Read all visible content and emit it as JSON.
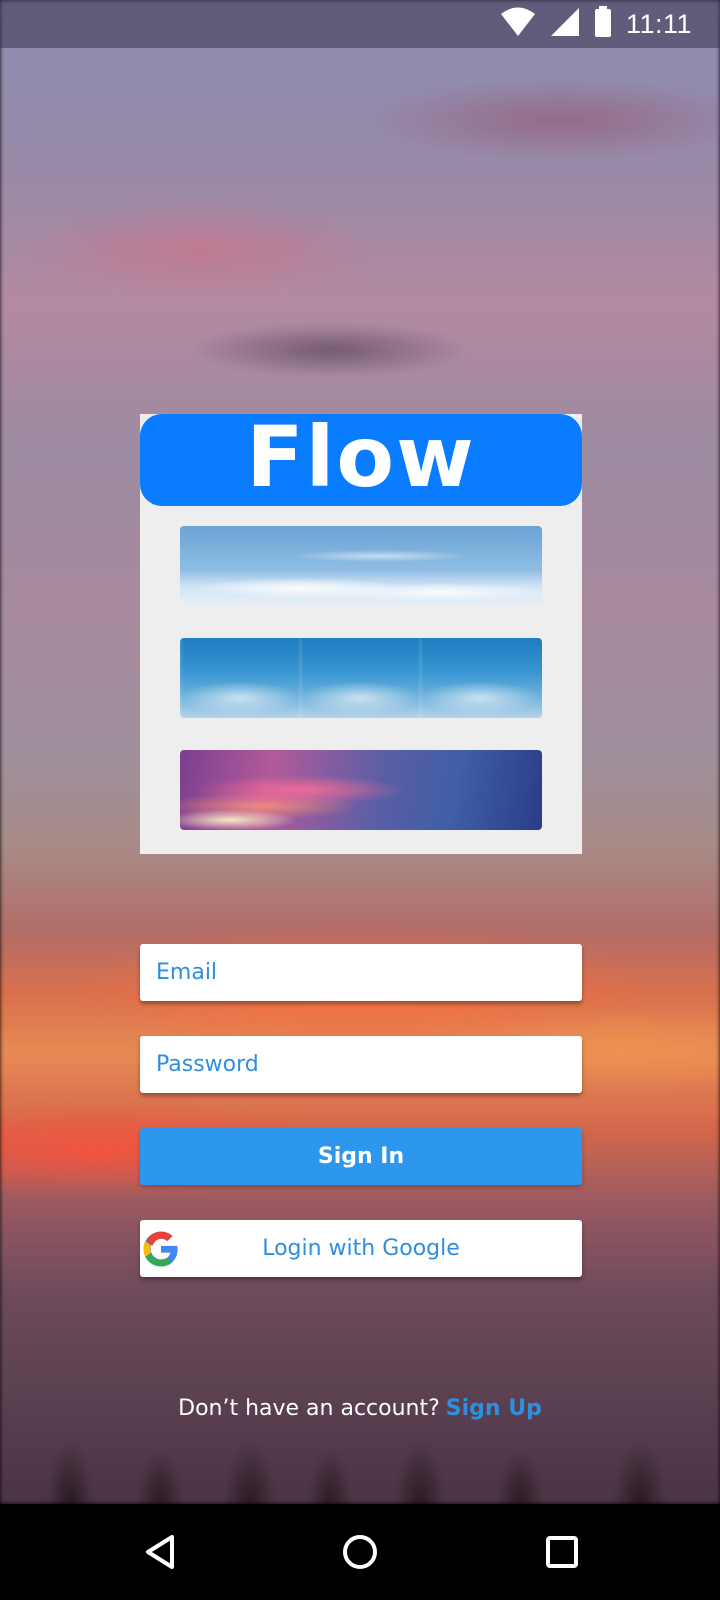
{
  "status_bar": {
    "time": "11:11",
    "icons": [
      "wifi-icon",
      "cellular-signal-icon",
      "battery-icon"
    ]
  },
  "header": {
    "app_title": "Flow"
  },
  "themes": [
    {
      "name": "clouds-above"
    },
    {
      "name": "blue-sky"
    },
    {
      "name": "sunset"
    }
  ],
  "login_form": {
    "email_placeholder": "Email",
    "password_placeholder": "Password",
    "signin_label": "Sign In",
    "google_label": "Login with Google"
  },
  "footer": {
    "prompt_text": "Don’t have an account?",
    "signup_label": "Sign Up"
  },
  "nav_bar": {
    "icons": [
      "back-icon",
      "home-icon",
      "recents-icon"
    ]
  },
  "colors": {
    "accent": "#2d97ee",
    "header_blue": "#0a7cff",
    "link": "#2e8ee0"
  }
}
